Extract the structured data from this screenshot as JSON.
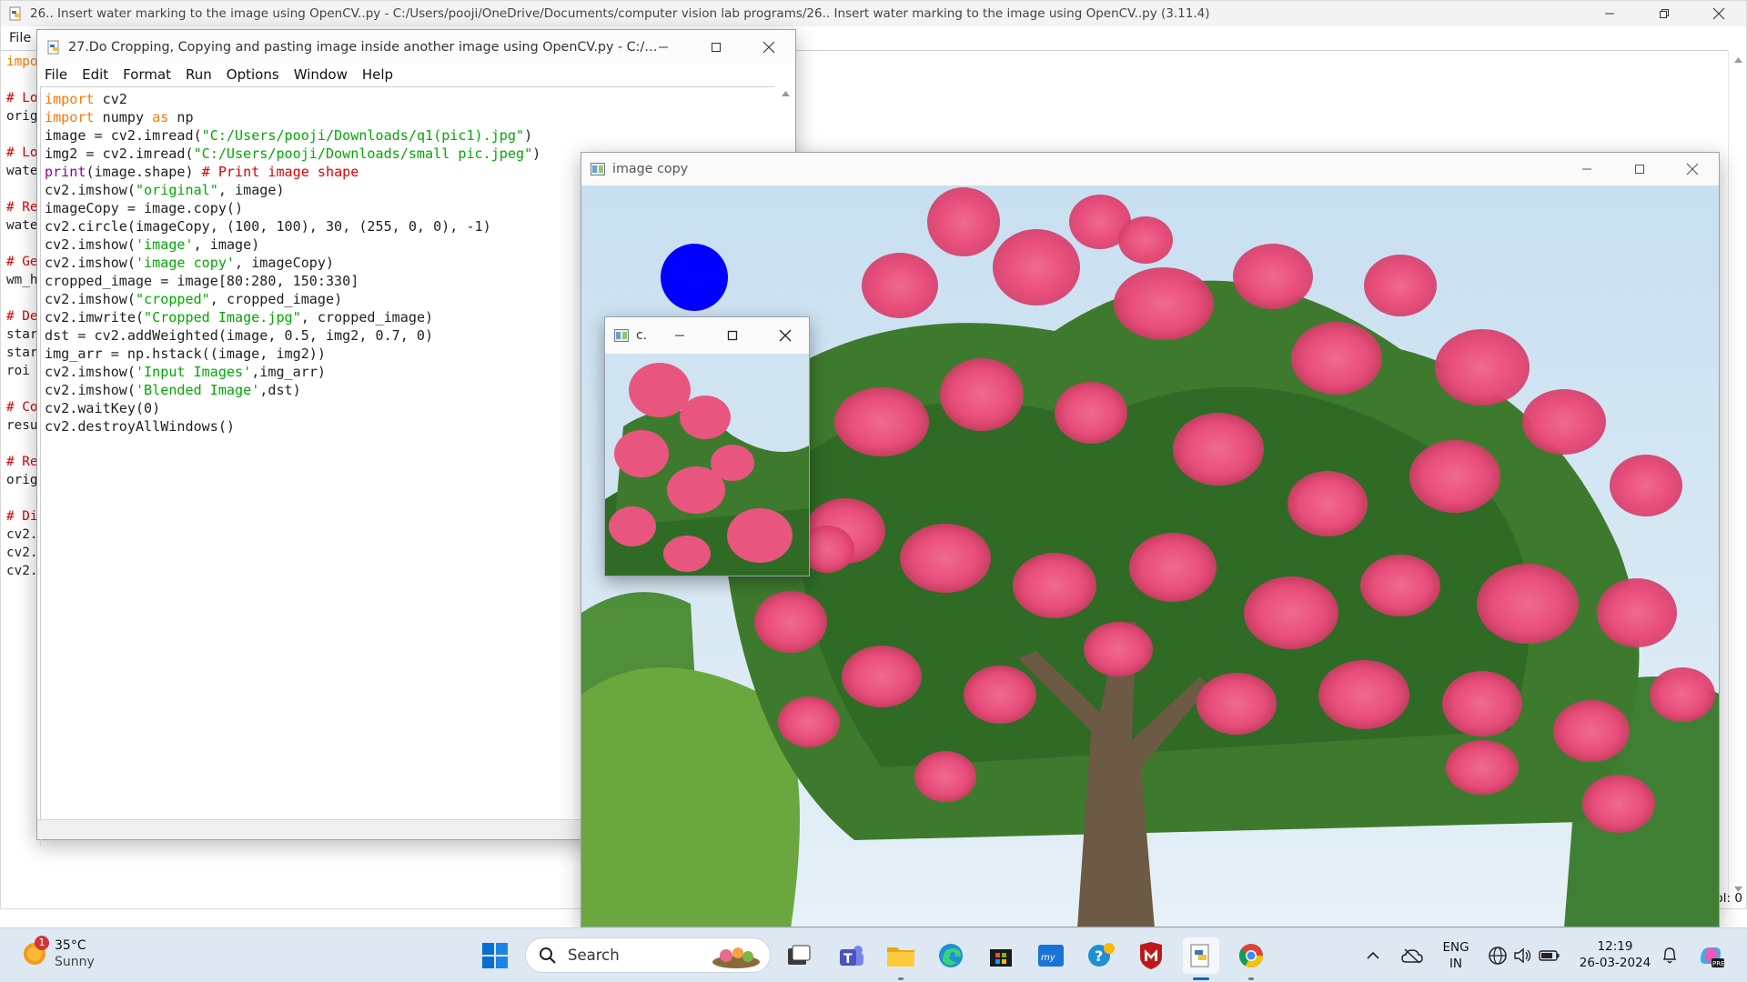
{
  "back_window": {
    "title": "26.. Insert water marking to the image using OpenCV..py - C:/Users/pooji/OneDrive/Documents/computer vision lab programs/26.. Insert water marking to the image using OpenCV..py (3.11.4)",
    "menu_file": "File",
    "visible_lines": [
      {
        "text": "impo",
        "type": "kw"
      },
      {
        "text": "",
        "type": "plain"
      },
      {
        "text": "# Lo",
        "type": "cm"
      },
      {
        "text": "orig",
        "type": "plain"
      },
      {
        "text": "",
        "type": "plain"
      },
      {
        "text": "# Lo",
        "type": "cm"
      },
      {
        "text": "wate",
        "type": "plain"
      },
      {
        "text": "",
        "type": "plain"
      },
      {
        "text": "# Re",
        "type": "cm"
      },
      {
        "text": "wate",
        "type": "plain"
      },
      {
        "text": "",
        "type": "plain"
      },
      {
        "text": "# Ge",
        "type": "cm"
      },
      {
        "text": "wm_h",
        "type": "plain"
      },
      {
        "text": "",
        "type": "plain"
      },
      {
        "text": "# De",
        "type": "cm"
      },
      {
        "text": "star",
        "type": "plain"
      },
      {
        "text": "star",
        "type": "plain"
      },
      {
        "text": "roi",
        "type": "plain"
      },
      {
        "text": "",
        "type": "plain"
      },
      {
        "text": "# Co",
        "type": "cm"
      },
      {
        "text": "resu",
        "type": "plain"
      },
      {
        "text": "",
        "type": "plain"
      },
      {
        "text": "# Re",
        "type": "cm"
      },
      {
        "text": "orig",
        "type": "plain"
      },
      {
        "text": "",
        "type": "plain"
      },
      {
        "text": "# Di",
        "type": "cm"
      },
      {
        "text": "cv2.",
        "type": "plain"
      },
      {
        "text": "cv2.",
        "type": "plain"
      },
      {
        "text": "cv2.",
        "type": "plain"
      }
    ],
    "status_col": "ol: 0"
  },
  "idle_window": {
    "title": "27.Do Cropping, Copying and pasting image inside another image using OpenCV.py - C:/Us...",
    "menu": [
      "File",
      "Edit",
      "Format",
      "Run",
      "Options",
      "Window",
      "Help"
    ],
    "code_lines": [
      [
        {
          "t": "import",
          "c": "kw"
        },
        {
          "t": " cv2",
          "c": ""
        }
      ],
      [
        {
          "t": "import",
          "c": "kw"
        },
        {
          "t": " numpy ",
          "c": ""
        },
        {
          "t": "as",
          "c": "kw"
        },
        {
          "t": " np",
          "c": ""
        }
      ],
      [
        {
          "t": "image = cv2.imread(",
          "c": ""
        },
        {
          "t": "\"C:/Users/pooji/Downloads/q1(pic1).jpg\"",
          "c": "str"
        },
        {
          "t": ")",
          "c": ""
        }
      ],
      [
        {
          "t": "img2 = cv2.imread(",
          "c": ""
        },
        {
          "t": "\"C:/Users/pooji/Downloads/small pic.jpeg\"",
          "c": "str"
        },
        {
          "t": ")",
          "c": ""
        }
      ],
      [
        {
          "t": "print",
          "c": "bi"
        },
        {
          "t": "(image.shape) ",
          "c": ""
        },
        {
          "t": "# Print image shape",
          "c": "cm"
        }
      ],
      [
        {
          "t": "cv2.imshow(",
          "c": ""
        },
        {
          "t": "\"original\"",
          "c": "str"
        },
        {
          "t": ", image)",
          "c": ""
        }
      ],
      [
        {
          "t": "imageCopy = image.copy()",
          "c": ""
        }
      ],
      [
        {
          "t": "cv2.circle(imageCopy, (100, 100), 30, (255, 0, 0), -1)",
          "c": ""
        }
      ],
      [
        {
          "t": "cv2.imshow(",
          "c": ""
        },
        {
          "t": "'image'",
          "c": "str"
        },
        {
          "t": ", image)",
          "c": ""
        }
      ],
      [
        {
          "t": "cv2.imshow(",
          "c": ""
        },
        {
          "t": "'image copy'",
          "c": "str"
        },
        {
          "t": ", imageCopy)",
          "c": ""
        }
      ],
      [
        {
          "t": "cropped_image = image[80:280, 150:330]",
          "c": ""
        }
      ],
      [
        {
          "t": "cv2.imshow(",
          "c": ""
        },
        {
          "t": "\"cropped\"",
          "c": "str"
        },
        {
          "t": ", cropped_image)",
          "c": ""
        }
      ],
      [
        {
          "t": "cv2.imwrite(",
          "c": ""
        },
        {
          "t": "\"Cropped Image.jpg\"",
          "c": "str"
        },
        {
          "t": ", cropped_image)",
          "c": ""
        }
      ],
      [
        {
          "t": "dst = cv2.addWeighted(image, 0.5, img2, 0.7, 0)",
          "c": ""
        }
      ],
      [
        {
          "t": "img_arr = np.hstack((image, img2))",
          "c": ""
        }
      ],
      [
        {
          "t": "cv2.imshow(",
          "c": ""
        },
        {
          "t": "'Input Images'",
          "c": "str"
        },
        {
          "t": ",img_arr)",
          "c": ""
        }
      ],
      [
        {
          "t": "cv2.imshow(",
          "c": ""
        },
        {
          "t": "'Blended Image'",
          "c": "str"
        },
        {
          "t": ",dst)",
          "c": ""
        }
      ],
      [
        {
          "t": "cv2.waitKey(0)",
          "c": ""
        }
      ],
      [
        {
          "t": "cv2.destroyAllWindows()",
          "c": ""
        }
      ]
    ]
  },
  "image_window": {
    "title": "image copy"
  },
  "cropped_window": {
    "title": "c."
  },
  "taskbar": {
    "weather_temp": "35°C",
    "weather_condition": "Sunny",
    "weather_badge": "1",
    "search_label": "Search",
    "lang_line1": "ENG",
    "lang_line2": "IN",
    "time": "12:19",
    "date": "26-03-2024",
    "apps": [
      "start",
      "search",
      "widgets-game",
      "task-view",
      "teams",
      "file-explorer",
      "edge",
      "microsoft-store",
      "mylip",
      "tips",
      "mcafee",
      "idle-python",
      "chrome"
    ]
  },
  "colors": {
    "accent": "#0067c0",
    "keyword": "#ff7700",
    "string": "#00aa00",
    "comment": "#dd0000",
    "builtin": "#900090",
    "circle": "#0000ff"
  }
}
